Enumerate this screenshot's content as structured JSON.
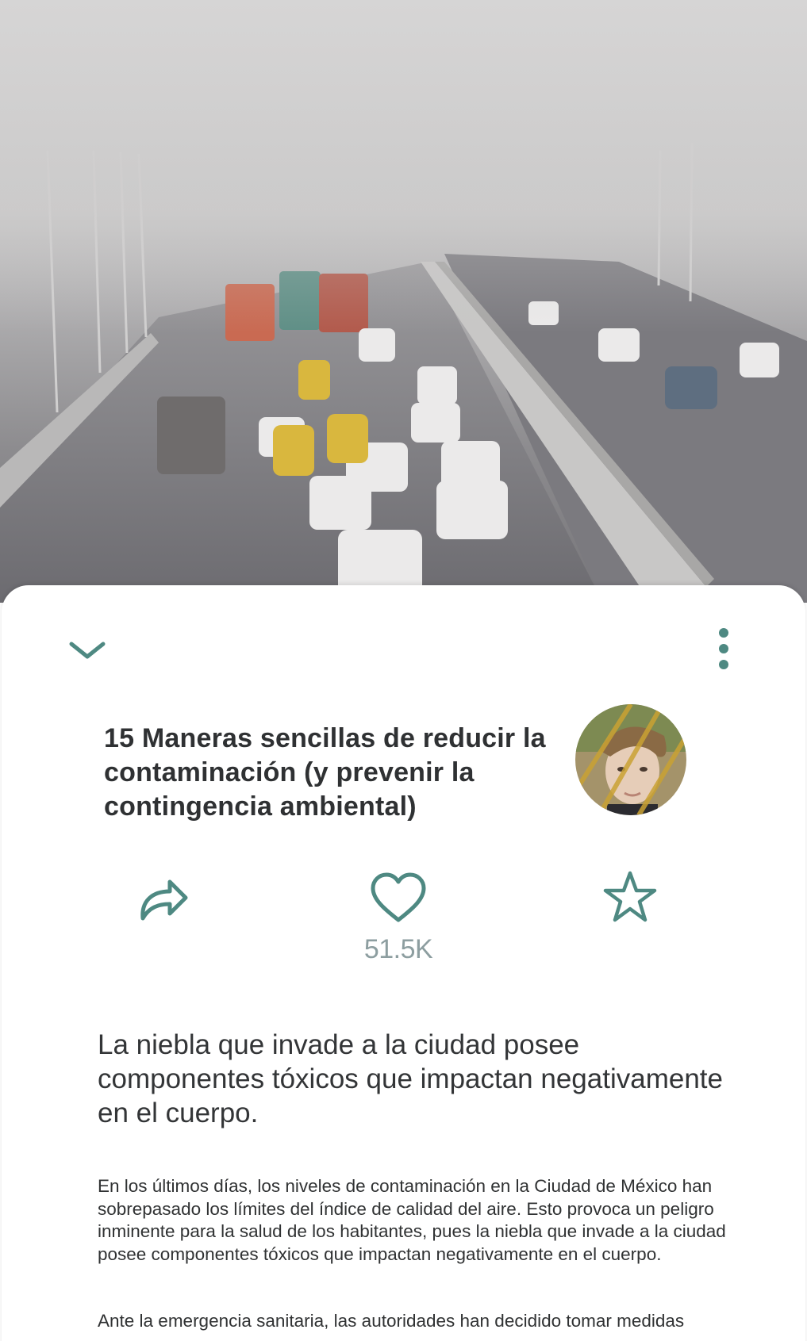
{
  "hero": {
    "image_alt": "Traffic on a smog-covered highway"
  },
  "toolbar": {
    "collapse_icon": "chevron-down-icon",
    "more_icon": "more-vertical-icon"
  },
  "article": {
    "title": "15 Maneras sencillas de reducir la contaminación (y prevenir la contingencia ambiental)",
    "author_avatar_icon": "avatar",
    "subtitle": "La niebla que invade a la ciudad posee componentes tóxicos que impactan negativamente en el cuerpo.",
    "paragraphs": [
      "En los últimos días, los niveles de contaminación en la Ciudad de México han sobrepasado los límites del índice de calidad del aire. Esto provoca un peligro inminente para la salud de los habitantes, pues la niebla que invade a la ciudad posee componentes tóxicos que impactan negativamente en el cuerpo.",
      "Ante la emergencia sanitaria, las autoridades han decidido tomar medidas"
    ]
  },
  "actions": {
    "share_icon": "share-icon",
    "like_icon": "heart-icon",
    "save_icon": "star-icon",
    "likes_count": "51.5K"
  },
  "colors": {
    "accent": "#4e8982",
    "title_text": "#2f3133",
    "likes_count": "#8d9ea0",
    "body_text": "#303233"
  }
}
